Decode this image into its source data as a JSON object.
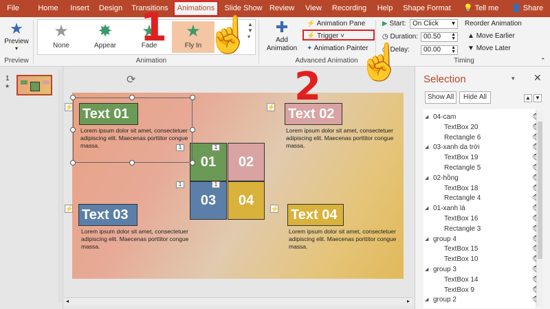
{
  "tabs": [
    "File",
    "Home",
    "Insert",
    "Design",
    "Transitions",
    "Animations",
    "Slide Show",
    "Review",
    "View",
    "Recording",
    "Help",
    "Shape Format"
  ],
  "tellme": "Tell me",
  "share": "Share",
  "ribbon": {
    "preview_label": "Preview",
    "preview_group": "Preview",
    "animations": [
      "None",
      "Appear",
      "Fade",
      "Fly In"
    ],
    "animation_group": "Animation",
    "add_animation": "Add Animation",
    "animation_pane": "Animation Pane",
    "trigger": "Trigger",
    "animation_painter": "Animation Painter",
    "advanced_group": "Advanced Animation",
    "start_label": "Start:",
    "start_value": "On Click",
    "duration_label": "Duration:",
    "duration_value": "00.50",
    "delay_label": "Delay:",
    "delay_value": "00.00",
    "timing_group": "Timing",
    "reorder_title": "Reorder Animation",
    "move_earlier": "Move Earlier",
    "move_later": "Move Later"
  },
  "thumb": {
    "number": "1",
    "star": "★"
  },
  "slide": {
    "text01": "Text 01",
    "text02": "Text 02",
    "text03": "Text 03",
    "text04": "Text 04",
    "lorem": "Lorem ipsum dolor sit amet, consectetuer adipiscing elit. Maecenas porttitor congue massa.",
    "cells": [
      "01",
      "02",
      "03",
      "04"
    ],
    "order_badge": "1"
  },
  "overlay": {
    "step1": "1",
    "step2": "2"
  },
  "pane": {
    "title": "Selection",
    "show_all": "Show All",
    "hide_all": "Hide All",
    "items": [
      {
        "label": "04-cam",
        "indent": 0
      },
      {
        "label": "TextBox 20",
        "indent": 1
      },
      {
        "label": "Rectangle 6",
        "indent": 1
      },
      {
        "label": "03-xanh da trời",
        "indent": 0
      },
      {
        "label": "TextBox 19",
        "indent": 1
      },
      {
        "label": "Rectangle 5",
        "indent": 1
      },
      {
        "label": "02-hồng",
        "indent": 0
      },
      {
        "label": "TextBox 18",
        "indent": 1
      },
      {
        "label": "Rectangle 4",
        "indent": 1
      },
      {
        "label": "01-xanh lá",
        "indent": 0
      },
      {
        "label": "TextBox 16",
        "indent": 1
      },
      {
        "label": "Rectangle 3",
        "indent": 1
      },
      {
        "label": "group 4",
        "indent": 0
      },
      {
        "label": "TextBox 15",
        "indent": 1
      },
      {
        "label": "TextBox 10",
        "indent": 1
      },
      {
        "label": "group 3",
        "indent": 0
      },
      {
        "label": "TextBox 14",
        "indent": 1
      },
      {
        "label": "TextBox 9",
        "indent": 1
      },
      {
        "label": "group 2",
        "indent": 0
      }
    ]
  },
  "colors": {
    "accent": "#b7472a",
    "highlight": "#e02020",
    "green": "#6a9a55",
    "pink": "#d9a3a3",
    "blue": "#5b7fa8",
    "yellow": "#d9b23c"
  }
}
